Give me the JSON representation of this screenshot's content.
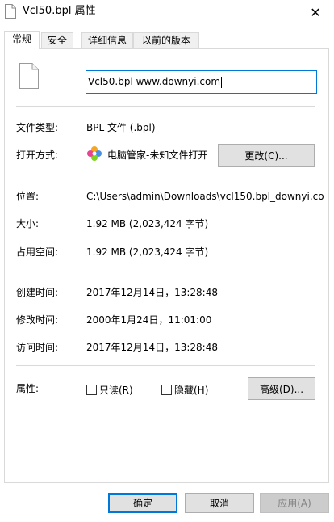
{
  "window": {
    "title": "Vcl50.bpl 属性",
    "close_glyph": "✕"
  },
  "tabs": [
    {
      "label": "常规",
      "active": true
    },
    {
      "label": "安全",
      "active": false
    },
    {
      "label": "详细信息",
      "active": false
    },
    {
      "label": "以前的版本",
      "active": false
    }
  ],
  "general": {
    "file_name": "Vcl50.bpl www.downyi.com",
    "type_label": "文件类型:",
    "type_value": "BPL 文件 (.bpl)",
    "opens_with_label": "打开方式:",
    "opens_with_value": "电脑管家-未知文件打开",
    "change_button": "更改(C)...",
    "location_label": "位置:",
    "location_value": "C:\\Users\\admin\\Downloads\\vcl150.bpl_downyi.co",
    "size_label": "大小:",
    "size_value": "1.92 MB (2,023,424 字节)",
    "size_on_disk_label": "占用空间:",
    "size_on_disk_value": "1.92 MB (2,023,424 字节)",
    "created_label": "创建时间:",
    "created_value": "2017年12月14日，13:28:48",
    "modified_label": "修改时间:",
    "modified_value": "2000年1月24日，11:01:00",
    "accessed_label": "访问时间:",
    "accessed_value": "2017年12月14日，13:28:48",
    "attributes_label": "属性:",
    "readonly_label": "只读(R)",
    "readonly_checked": false,
    "hidden_label": "隐藏(H)",
    "hidden_checked": false,
    "advanced_button": "高级(D)..."
  },
  "footer": {
    "ok": "确定",
    "cancel": "取消",
    "apply": "应用(A)"
  },
  "colors": {
    "accent": "#0078d7",
    "button_face": "#e1e1e1",
    "border": "#d9d9d9",
    "disabled_text": "#838383"
  }
}
